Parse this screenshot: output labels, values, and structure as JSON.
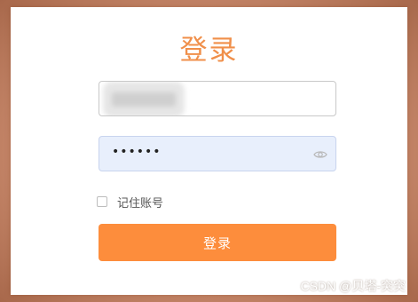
{
  "form": {
    "title": "登录",
    "username_value": "",
    "password_value": "••••••",
    "remember_label": "记住账号",
    "remember_checked": false,
    "submit_label": "登录"
  },
  "icons": {
    "password_toggle": "eye-icon"
  },
  "colors": {
    "accent": "#fd8d3c",
    "title": "#f08f4a",
    "password_bg": "#e8effc"
  },
  "watermark": "CSDN @贝塔-突突"
}
